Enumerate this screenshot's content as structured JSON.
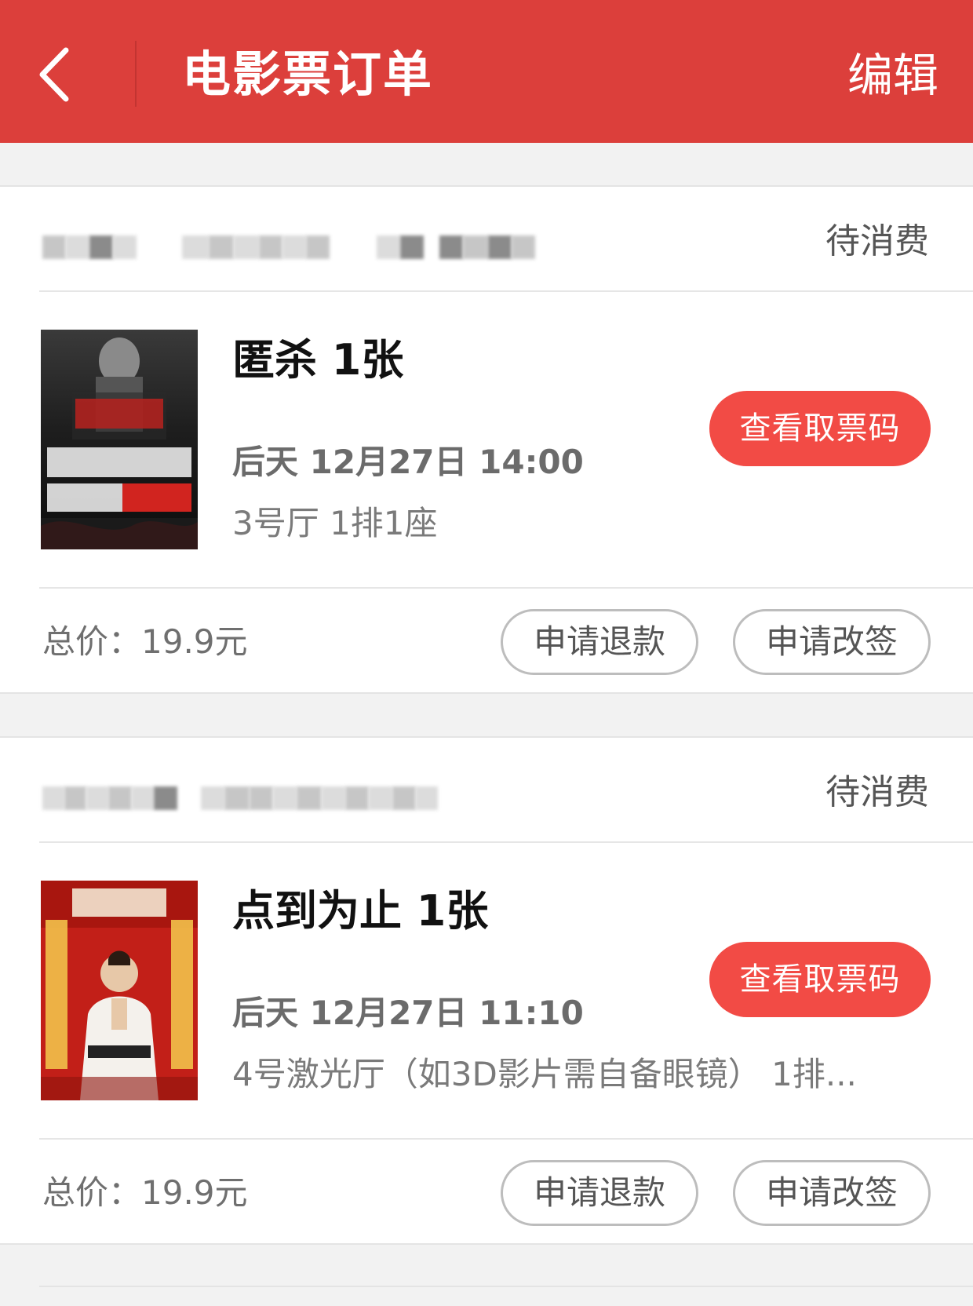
{
  "header": {
    "title": "电影票订单",
    "edit_label": "编辑"
  },
  "colors": {
    "header_bg": "#dc3f3b",
    "primary_button": "#f24b45"
  },
  "orders": [
    {
      "cinema_name": "",
      "status": "待消费",
      "movie_title": "匿杀 1张",
      "showtime": "后天 12月27日 14:00",
      "seat": "3号厅 1排1座",
      "ticket_code_label": "查看取票码",
      "total_price": "总价：19.9元",
      "refund_label": "申请退款",
      "change_label": "申请改签",
      "poster_icon": "movie-poster-dark"
    },
    {
      "cinema_name": "",
      "status": "待消费",
      "movie_title": "点到为止 1张",
      "showtime": "后天 12月27日 11:10",
      "seat": "4号激光厅（如3D影片需自备眼镜） 1排...",
      "ticket_code_label": "查看取票码",
      "total_price": "总价：19.9元",
      "refund_label": "申请退款",
      "change_label": "申请改签",
      "poster_icon": "movie-poster-red"
    }
  ]
}
